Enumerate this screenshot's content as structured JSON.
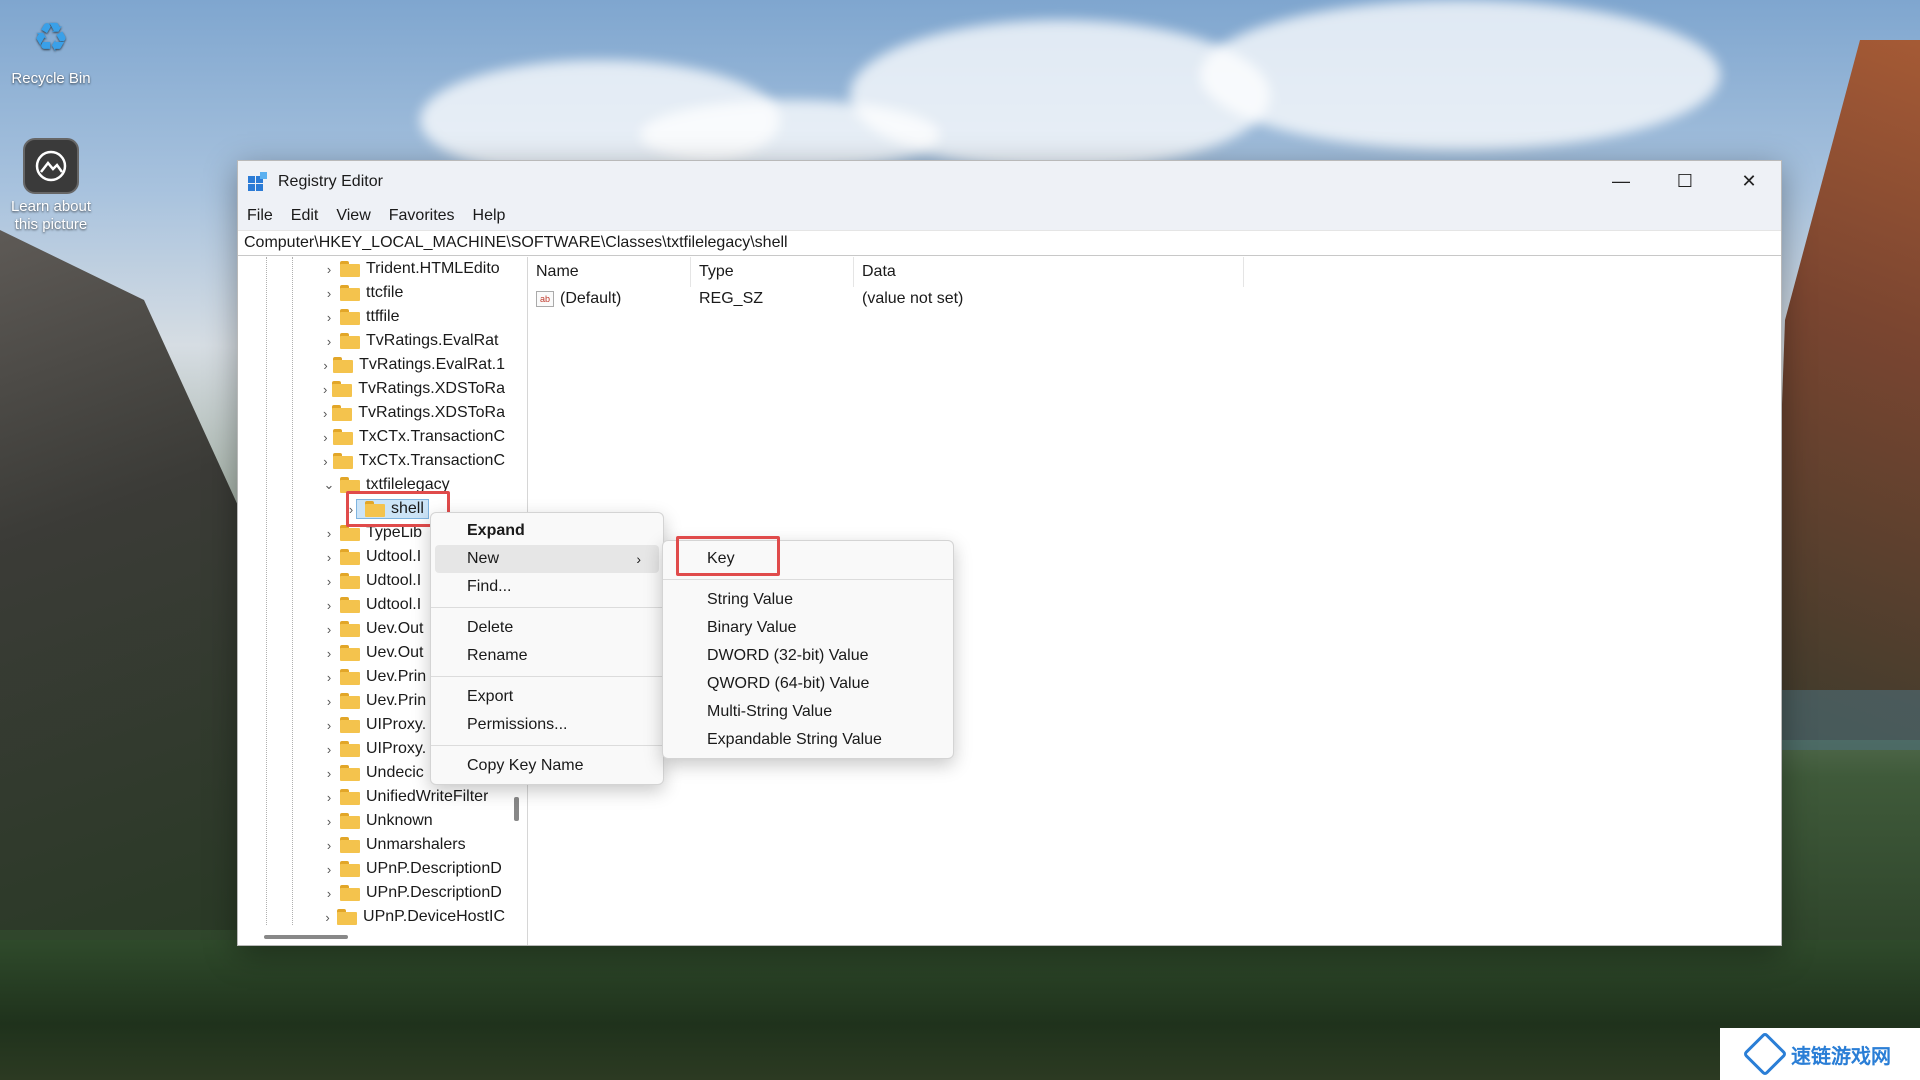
{
  "desktop": {
    "icons": [
      {
        "label": "Recycle Bin"
      },
      {
        "label": "Learn about this picture"
      }
    ],
    "watermark": "速链游戏网"
  },
  "window": {
    "title": "Registry Editor",
    "controls": {
      "minimize": "—",
      "maximize": "☐",
      "close": "✕"
    },
    "menu": [
      "File",
      "Edit",
      "View",
      "Favorites",
      "Help"
    ],
    "address": "Computer\\HKEY_LOCAL_MACHINE\\SOFTWARE\\Classes\\txtfilelegacy\\shell"
  },
  "tree": {
    "items": [
      {
        "label": "Trident.HTMLEdito",
        "expanded": false
      },
      {
        "label": "ttcfile",
        "expanded": false
      },
      {
        "label": "ttffile",
        "expanded": false
      },
      {
        "label": "TvRatings.EvalRat",
        "expanded": false
      },
      {
        "label": "TvRatings.EvalRat.1",
        "expanded": false
      },
      {
        "label": "TvRatings.XDSToRa",
        "expanded": false
      },
      {
        "label": "TvRatings.XDSToRa",
        "expanded": false
      },
      {
        "label": "TxCTx.TransactionC",
        "expanded": false
      },
      {
        "label": "TxCTx.TransactionC",
        "expanded": false
      },
      {
        "label": "txtfilelegacy",
        "expanded": true
      },
      {
        "label": "shell",
        "selected": true
      },
      {
        "label": "TypeLib",
        "expanded": false
      },
      {
        "label": "Udtool.I",
        "expanded": false
      },
      {
        "label": "Udtool.I",
        "expanded": false
      },
      {
        "label": "Udtool.I",
        "expanded": false
      },
      {
        "label": "Uev.Out",
        "expanded": false
      },
      {
        "label": "Uev.Out",
        "expanded": false
      },
      {
        "label": "Uev.Prin",
        "expanded": false
      },
      {
        "label": "Uev.Prin",
        "expanded": false
      },
      {
        "label": "UIProxy.",
        "expanded": false
      },
      {
        "label": "UIProxy.",
        "expanded": false
      },
      {
        "label": "Undecic",
        "expanded": false
      },
      {
        "label": "UnifiedWriteFilter",
        "expanded": false
      },
      {
        "label": "Unknown",
        "expanded": false
      },
      {
        "label": "Unmarshalers",
        "expanded": false
      },
      {
        "label": "UPnP.DescriptionD",
        "expanded": false
      },
      {
        "label": "UPnP.DescriptionD",
        "expanded": false
      },
      {
        "label": "UPnP.DeviceHostIC",
        "expanded": false
      }
    ]
  },
  "values": {
    "columns": [
      "Name",
      "Type",
      "Data"
    ],
    "rows": [
      {
        "name": "(Default)",
        "type": "REG_SZ",
        "data": "(value not set)"
      }
    ]
  },
  "context_menu": {
    "items": [
      "Expand",
      "New",
      "Find...",
      "Delete",
      "Rename",
      "Export",
      "Permissions...",
      "Copy Key Name"
    ],
    "arrow": "›"
  },
  "submenu": {
    "items": [
      "Key",
      "String Value",
      "Binary Value",
      "DWORD (32-bit) Value",
      "QWORD (64-bit) Value",
      "Multi-String Value",
      "Expandable String Value"
    ]
  },
  "colors": {
    "highlight": "#e04b4b",
    "accent": "#2b7bd6"
  }
}
